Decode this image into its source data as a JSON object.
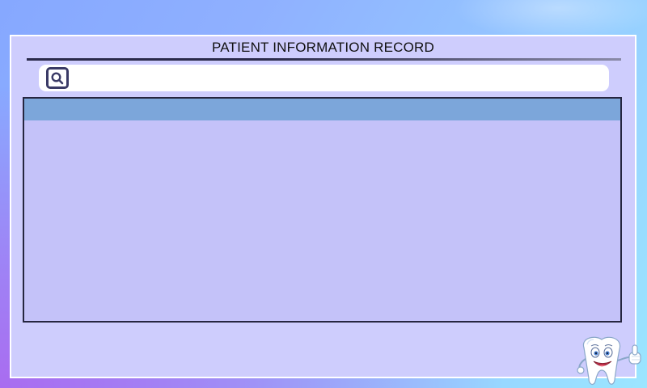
{
  "window": {
    "title": "PATIENT INFORMATION RECORD"
  },
  "search": {
    "value": "",
    "placeholder": "",
    "icon": "search-icon"
  },
  "table": {
    "columns": [],
    "rows": []
  },
  "mascot": {
    "icon": "tooth-mascot-icon"
  },
  "colors": {
    "panel": "#cecdfd",
    "table_header": "#7ca6da",
    "table_body": "#c4c2f9",
    "border_dark": "#262640",
    "accent_purple": "#a96cf0"
  }
}
